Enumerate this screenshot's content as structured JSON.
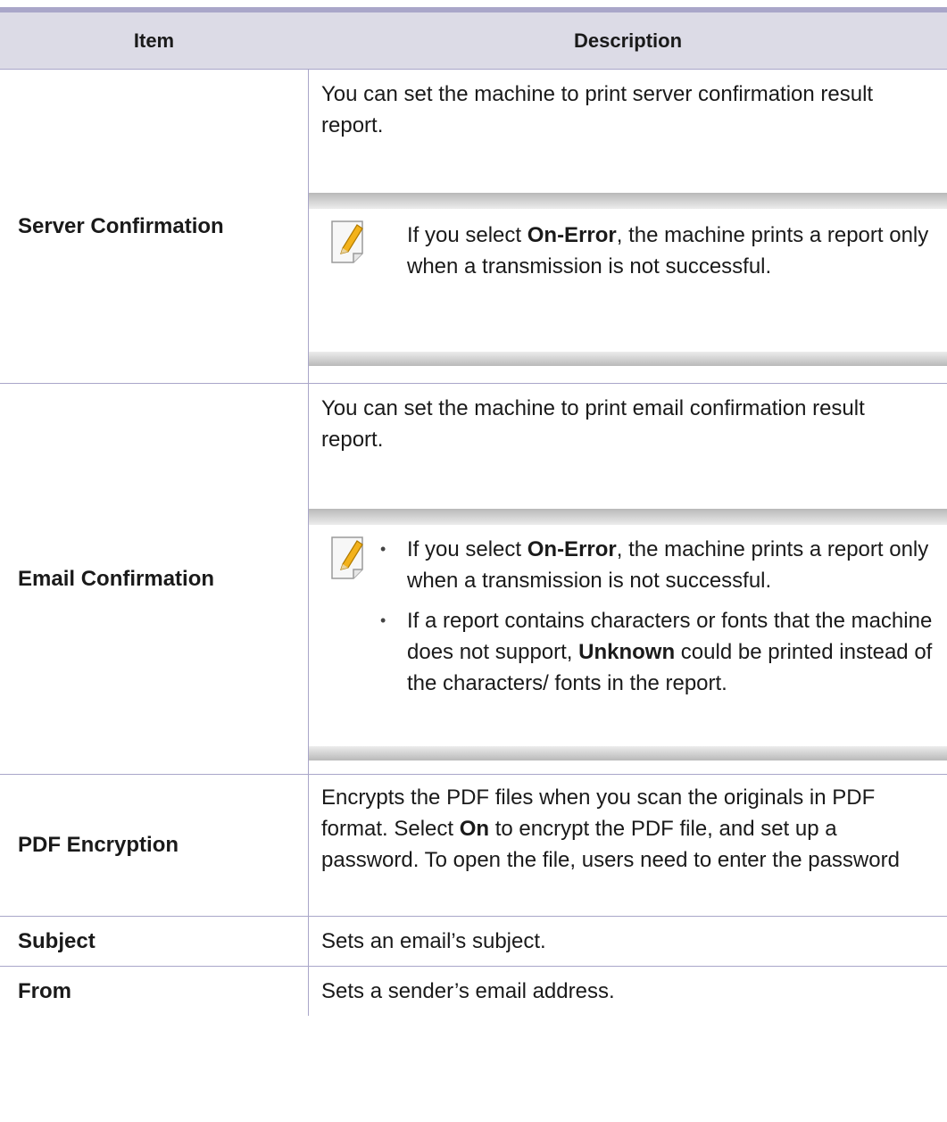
{
  "header": {
    "item": "Item",
    "description": "Description"
  },
  "rows": [
    {
      "item": "Server Confirmation",
      "description": "You can set the machine to print server confirmation result report.",
      "note": {
        "pre": "If you select ",
        "bold": "On-Error",
        "post": ", the machine prints a report only when a transmission is not successful."
      }
    },
    {
      "item": "Email Confirmation",
      "description": "You can set the machine to print email confirmation result report.",
      "note_bullets": [
        {
          "pre": "If you select ",
          "bold": "On-Error",
          "post": ", the machine prints a report only when a transmission is not successful."
        },
        {
          "pre": "If a report contains characters or fonts that the machine does not support, ",
          "bold": "Unknown",
          "post": " could be printed instead of the characters/ fonts in the report."
        }
      ]
    },
    {
      "item": "PDF Encryption",
      "description": {
        "pre": "Encrypts the PDF files when you scan the originals in PDF format. Select ",
        "bold": "On",
        "post": " to encrypt the PDF file, and set up a password. To open the file, users need to enter the password"
      }
    },
    {
      "item": "Subject",
      "description": "Sets an email’s subject."
    },
    {
      "item": "From",
      "description": "Sets a sender’s email address."
    }
  ],
  "icons": {
    "note": "note-pencil-icon"
  },
  "colors": {
    "rule": "#a9a6c9",
    "header_bg": "#dcdbe6"
  }
}
